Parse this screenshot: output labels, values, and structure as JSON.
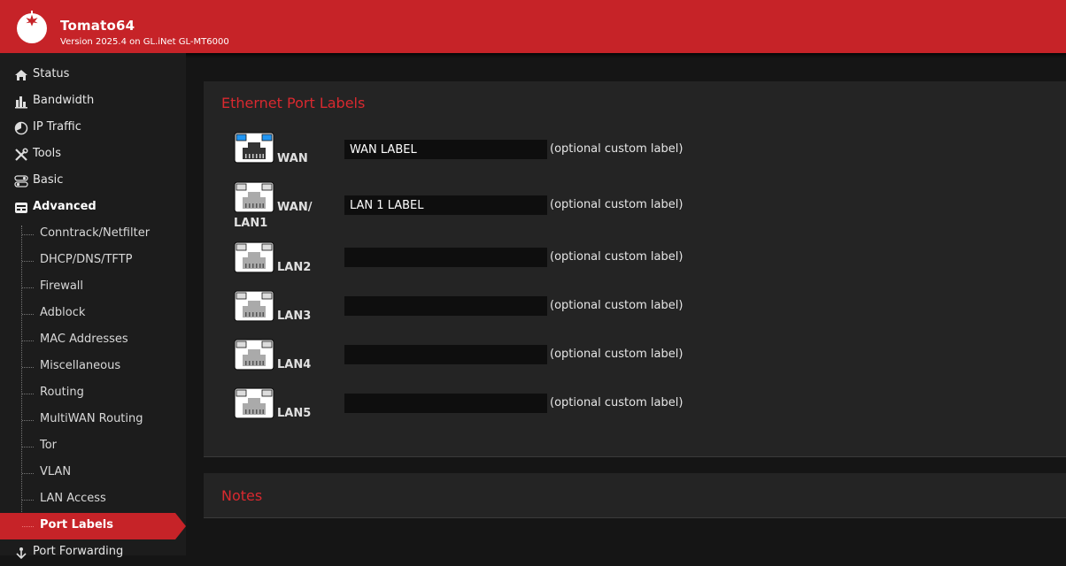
{
  "header": {
    "title": "Tomato64",
    "version": "Version 2025.4 on GL.iNet GL-MT6000",
    "logo_icon": "tomato-logo-icon",
    "brand_color": "#c62328"
  },
  "sidebar": {
    "items": [
      {
        "label": "Status",
        "icon": "home-icon"
      },
      {
        "label": "Bandwidth",
        "icon": "bar-chart-icon"
      },
      {
        "label": "IP Traffic",
        "icon": "pie-icon"
      },
      {
        "label": "Tools",
        "icon": "tools-icon"
      },
      {
        "label": "Basic",
        "icon": "toggles-icon"
      },
      {
        "label": "Advanced",
        "icon": "advanced-icon"
      }
    ],
    "sub_items": [
      {
        "label": "Conntrack/Netfilter"
      },
      {
        "label": "DHCP/DNS/TFTP"
      },
      {
        "label": "Firewall"
      },
      {
        "label": "Adblock"
      },
      {
        "label": "MAC Addresses"
      },
      {
        "label": "Miscellaneous"
      },
      {
        "label": "Routing"
      },
      {
        "label": "MultiWAN Routing"
      },
      {
        "label": "Tor"
      },
      {
        "label": "VLAN"
      },
      {
        "label": "LAN Access"
      },
      {
        "label": "Port Labels"
      }
    ],
    "after_items": [
      {
        "label": "Port Forwarding",
        "icon": "port-forward-icon"
      }
    ]
  },
  "main": {
    "section_title": "Ethernet Port Labels",
    "notes_title": "Notes",
    "ports": [
      {
        "name": "WAN",
        "value": "WAN LABEL",
        "hint": "(optional custom label)",
        "icon": "ethernet-port-wan-icon"
      },
      {
        "name": "WAN/",
        "name_line2": "LAN1",
        "value": "LAN 1 LABEL",
        "hint": "(optional custom label)",
        "icon": "ethernet-port-icon"
      },
      {
        "name": "LAN2",
        "value": "",
        "hint": "(optional custom label)",
        "icon": "ethernet-port-icon"
      },
      {
        "name": "LAN3",
        "value": "",
        "hint": "(optional custom label)",
        "icon": "ethernet-port-icon"
      },
      {
        "name": "LAN4",
        "value": "",
        "hint": "(optional custom label)",
        "icon": "ethernet-port-icon"
      },
      {
        "name": "LAN5",
        "value": "",
        "hint": "(optional custom label)",
        "icon": "ethernet-port-icon"
      }
    ]
  }
}
